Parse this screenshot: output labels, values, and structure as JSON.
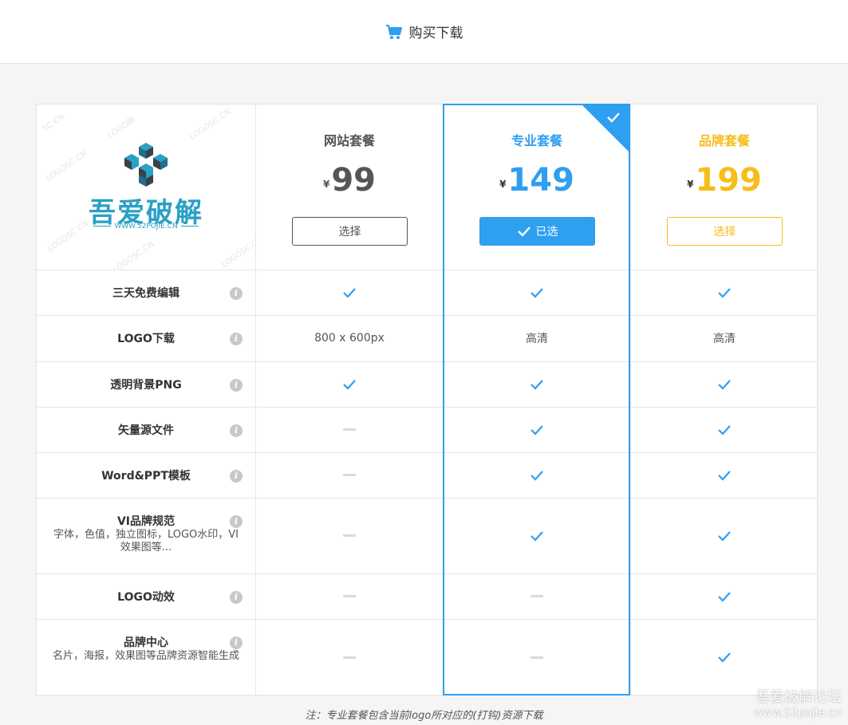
{
  "header": {
    "icon": "shopping-cart-icon",
    "title": "购买下载"
  },
  "brand": {
    "name": "吾爱破解",
    "url": "WWW.52POJIE.CN",
    "watermarks": [
      "LOGO牌",
      "LOGOSC.CN",
      "LOGOSC.CN",
      "LOGOSC.CN",
      "LOGOSC.CN",
      "LOGOSC.CN",
      "SC.CN"
    ],
    "color": "#2aa0c5"
  },
  "currency": "¥",
  "plans": [
    {
      "name": "网站套餐",
      "price": "99",
      "button": "选择",
      "color": "#555555",
      "selected": false
    },
    {
      "name": "专业套餐",
      "price": "149",
      "button": "已选",
      "color": "#2f9ff0",
      "selected": true
    },
    {
      "name": "品牌套餐",
      "price": "199",
      "button": "选择",
      "color": "#f7bd1a",
      "selected": false
    }
  ],
  "features": [
    {
      "name": "三天免费编辑",
      "desc": "",
      "values": [
        "check",
        "check",
        "check"
      ]
    },
    {
      "name": "LOGO下载",
      "desc": "",
      "values": [
        "800 x 600px",
        "高清",
        "高清"
      ]
    },
    {
      "name": "透明背景PNG",
      "desc": "",
      "values": [
        "check",
        "check",
        "check"
      ]
    },
    {
      "name": "矢量源文件",
      "desc": "",
      "values": [
        "dash",
        "check",
        "check"
      ]
    },
    {
      "name": "Word&PPT模板",
      "desc": "",
      "values": [
        "dash",
        "check",
        "check"
      ]
    },
    {
      "name": "VI品牌规范",
      "desc": "字体，色值，独立图标，LOGO水印，VI效果图等...",
      "values": [
        "dash",
        "check",
        "check"
      ]
    },
    {
      "name": "LOGO动效",
      "desc": "",
      "values": [
        "dash",
        "dash",
        "check"
      ]
    },
    {
      "name": "品牌中心",
      "desc": "名片，海报，效果图等品牌资源智能生成",
      "values": [
        "dash",
        "dash",
        "check"
      ]
    }
  ],
  "info_icon": "i",
  "note": "注：专业套餐包含当前logo所对应的(打钩)资源下载",
  "site_watermark": {
    "title": "吾爱破解论坛",
    "url": "www.52pojie.cn"
  },
  "colors": {
    "accent": "#2f9ff0",
    "gold": "#f7bd1a",
    "check": "#2f9ff0",
    "dash": "#d9d9d9"
  }
}
